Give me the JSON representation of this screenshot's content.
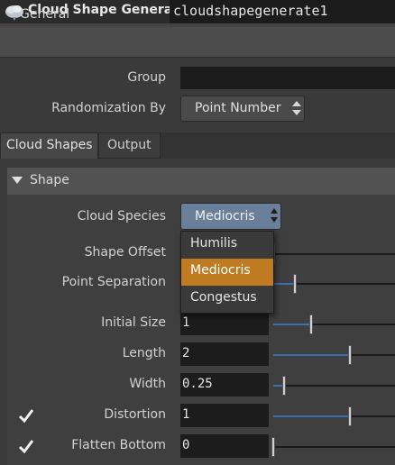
{
  "node": {
    "type_label": "Cloud Shape Generate",
    "name": "cloudshapegenerate1"
  },
  "general": {
    "title": "General",
    "group_label": "Group",
    "group_value": "",
    "randomization_label": "Randomization By",
    "randomization_value": "Point Number"
  },
  "tabs": [
    {
      "label": "Cloud Shapes",
      "active": true
    },
    {
      "label": "Output",
      "active": false
    }
  ],
  "shape": {
    "title": "Shape",
    "species_label": "Cloud Species",
    "species_value": "Mediocris",
    "species_options": [
      "Humilis",
      "Mediocris",
      "Congestus"
    ],
    "params": [
      {
        "label": "Shape Offset",
        "value": "",
        "slider": 0.0,
        "checkbox": false
      },
      {
        "label": "Point Separation",
        "value": "",
        "slider": 0.18,
        "checkbox": false
      },
      {
        "label": "Initial Size",
        "value": "1",
        "slider": 0.31,
        "checkbox": false
      },
      {
        "label": "Length",
        "value": "2",
        "slider": 0.63,
        "checkbox": false
      },
      {
        "label": "Width",
        "value": "0.25",
        "slider": 0.09,
        "checkbox": false
      },
      {
        "label": "Distortion",
        "value": "1",
        "slider": 0.63,
        "checkbox": true,
        "checked": true
      },
      {
        "label": "Flatten Bottom",
        "value": "0",
        "slider": 0.0,
        "checkbox": true,
        "checked": true
      }
    ]
  },
  "colors": {
    "accent_selected": "#c07a21",
    "menu_active": "#6a7f9a",
    "slider_fill": "#3d6fb0"
  },
  "icons": {
    "node": "cloud-icon",
    "menu_arrows": "updown-arrows-icon",
    "folder": "triangle-down-icon",
    "check": "checkmark-icon"
  }
}
